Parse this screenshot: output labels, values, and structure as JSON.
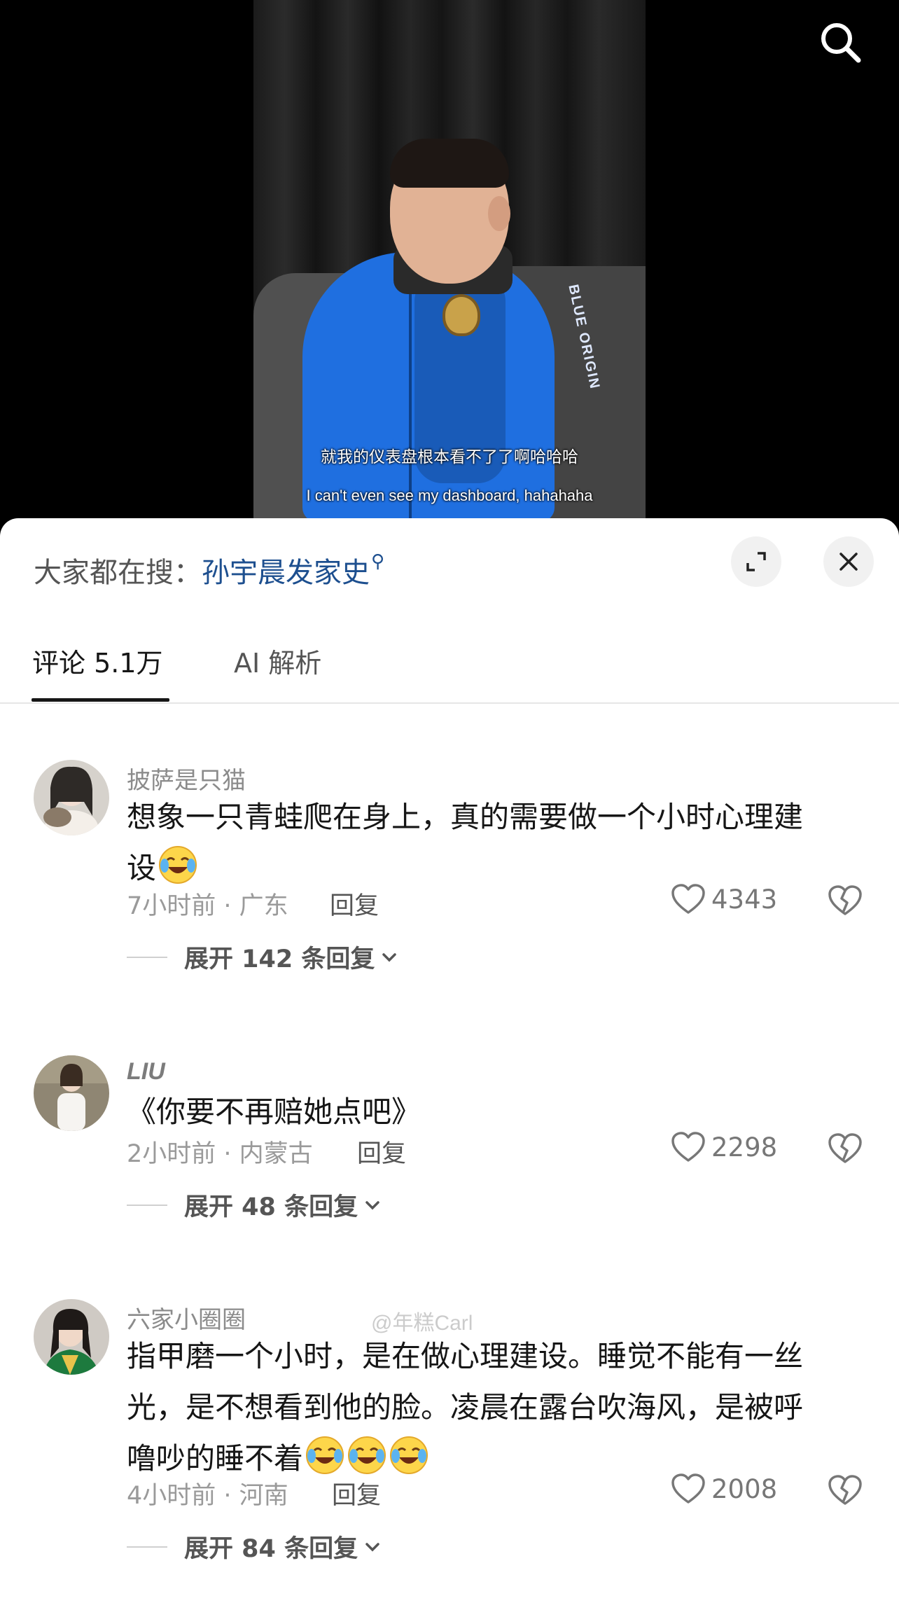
{
  "video": {
    "subtitle_cn": "就我的仪表盘根本看不了了啊哈哈哈",
    "subtitle_en": "I can't even see my dashboard, hahahaha",
    "jacket_text": "BLUE ORIGIN"
  },
  "hot_search": {
    "prefix": "大家都在搜：",
    "term": "孙宇晨发家史"
  },
  "tabs": [
    {
      "label": "评论 5.1万",
      "active": true
    },
    {
      "label": "AI 解析",
      "active": false
    }
  ],
  "watermark": "@年糕Carl",
  "comments": [
    {
      "username": "披萨是只猫",
      "text_lines": [
        "想象一只青蛙爬在身上，真的需要做一个小时心理建",
        "设"
      ],
      "emoji_count": 1,
      "time_location": "7小时前 · 广东",
      "reply_label": "回复",
      "likes": "4343",
      "expand_label": "展开 142 条回复"
    },
    {
      "username": "LIU",
      "text_lines": [
        "《你要不再赔她点吧》"
      ],
      "emoji_count": 0,
      "time_location": "2小时前 · 内蒙古",
      "reply_label": "回复",
      "likes": "2298",
      "expand_label": "展开 48 条回复"
    },
    {
      "username": "六家小圈圈",
      "text_lines": [
        "指甲磨一个小时，是在做心理建设。睡觉不能有一丝",
        "光，是不想看到他的脸。凌晨在露台吹海风，是被呼",
        "噜吵的睡不着"
      ],
      "emoji_count": 3,
      "time_location": "4小时前 · 河南",
      "reply_label": "回复",
      "likes": "2008",
      "expand_label": "展开 84 条回复"
    }
  ],
  "icons": {
    "search": "search-icon",
    "expand": "expand-icon",
    "close": "close-icon",
    "like": "heart-outline-icon",
    "dislike": "broken-heart-icon",
    "chevron": "chevron-down-icon",
    "emoji": "crying-laughing-emoji"
  },
  "colors": {
    "hot_search_term": "#1d4f8f",
    "jacket_blue": "#1f6fe0",
    "text_primary": "#161616",
    "text_secondary": "#9a9a9a"
  }
}
